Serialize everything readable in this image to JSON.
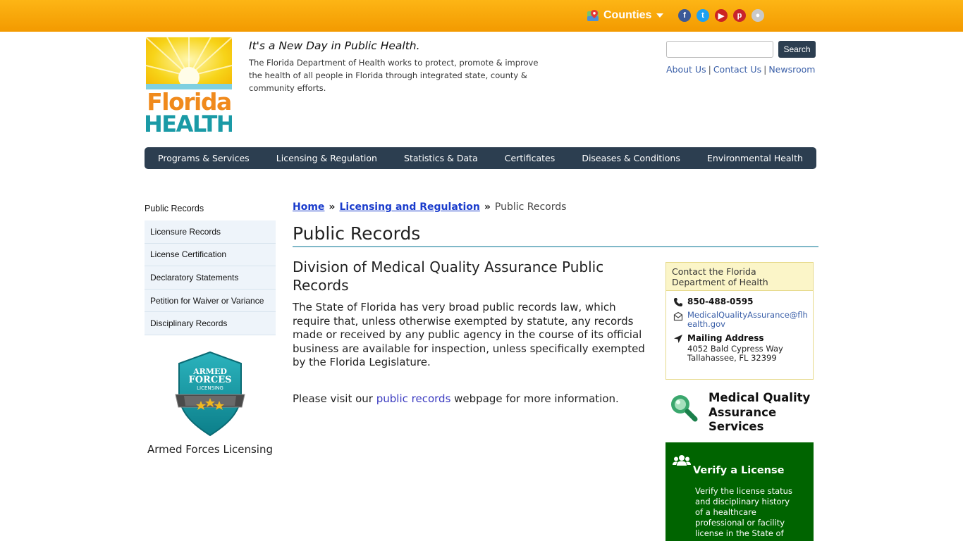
{
  "topbar": {
    "counties_label": "Counties",
    "social": [
      {
        "name": "facebook-icon",
        "glyph": "f",
        "color": "#3b5998"
      },
      {
        "name": "twitter-icon",
        "glyph": "t",
        "color": "#1da1f2"
      },
      {
        "name": "youtube-icon",
        "glyph": "▶",
        "color": "#cc2222"
      },
      {
        "name": "pinterest-icon",
        "glyph": "p",
        "color": "#c8232c"
      },
      {
        "name": "flickr-icon",
        "glyph": "●",
        "color": "#c9c9c9"
      }
    ]
  },
  "header": {
    "logo_text_top": "Florida",
    "logo_text_bottom": "HEALTH",
    "tagline": "It's a New Day in Public Health.",
    "mission": "The Florida Department of Health works to protect, promote & improve the health of all people in Florida through integrated state, county & community efforts.",
    "search_button": "Search",
    "util_links": [
      "About Us",
      "Contact Us",
      "Newsroom"
    ]
  },
  "nav": {
    "items": [
      "Programs & Services",
      "Licensing & Regulation",
      "Statistics & Data",
      "Certificates",
      "Diseases & Conditions",
      "Environmental Health"
    ]
  },
  "sidebar": {
    "title": "Public Records",
    "items": [
      "Licensure Records",
      "License Certification",
      "Declaratory Statements",
      "Petition for Waiver or Variance",
      "Disciplinary Records"
    ],
    "badge_text": [
      "ARMED",
      "FORCES",
      "LICENSING"
    ],
    "badge_caption": "Armed Forces Licensing"
  },
  "content": {
    "breadcrumb": {
      "home": "Home",
      "licensing": "Licensing and Regulation",
      "current": "Public Records",
      "separator": "»"
    },
    "page_title": "Public Records",
    "section_title": "Division of Medical Quality Assurance Public Records",
    "body": "The State of Florida has very broad public records law, which require that, unless otherwise exempted by statute, any records made or received by any public agency in the course of its official business are available for inspection, unless specifically exempted by the Florida Legislature.",
    "visit_prefix": "Please visit our ",
    "visit_link": "public records",
    "visit_suffix": " webpage for more information."
  },
  "contact": {
    "heading": "Contact the Florida Department of Health",
    "phone": "850-488-0595",
    "email": "MedicalQualityAssurance@flhealth.gov",
    "mailing_label": "Mailing Address",
    "address_line1": "4052 Bald Cypress Way",
    "address_line2": "Tallahassee, FL 32399"
  },
  "mqa": {
    "title": "Medical Quality Assurance Services"
  },
  "verify": {
    "title": "Verify a License",
    "text": "Verify the license status and disciplinary history of a healthcare professional or facility license in the State of"
  },
  "colors": {
    "topbar": "#f5a300",
    "nav": "#2c3e50",
    "verify_green": "#006400",
    "link": "#3a5fa8"
  }
}
